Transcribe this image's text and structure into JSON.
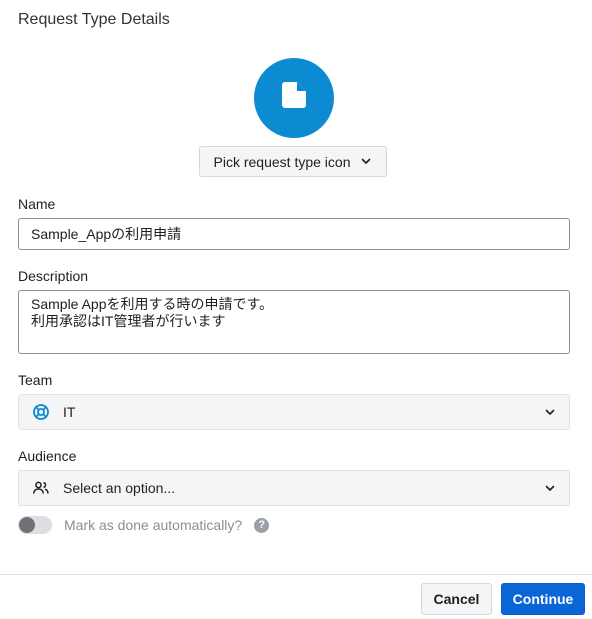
{
  "dialog": {
    "title": "Request Type Details"
  },
  "icon_picker": {
    "icon": "document-icon",
    "button_label": "Pick request type icon",
    "color": "#0c8bd3"
  },
  "name": {
    "label": "Name",
    "value": "Sample_Appの利用申請"
  },
  "description": {
    "label": "Description",
    "line1": "Sample Appを利用する時の申請です。",
    "line2": "利用承認はIT管理者が行います"
  },
  "team": {
    "label": "Team",
    "icon": "lifebuoy-icon",
    "value": "IT"
  },
  "audience": {
    "label": "Audience",
    "icon": "users-icon",
    "placeholder": "Select an option..."
  },
  "auto_done": {
    "label": "Mark as done automatically?",
    "enabled": false
  },
  "footer": {
    "cancel_label": "Cancel",
    "continue_label": "Continue",
    "accent": "#0a66d6"
  }
}
